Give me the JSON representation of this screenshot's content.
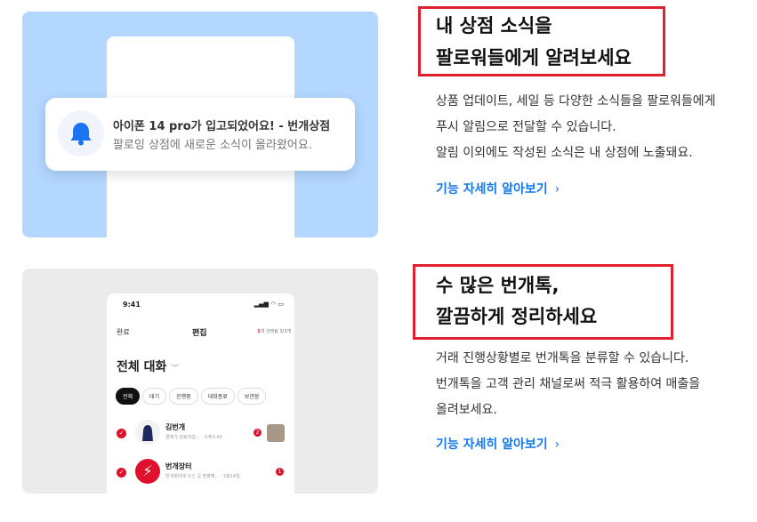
{
  "section1": {
    "notification": {
      "title": "아이폰 14 pro가 입고되었어요! - 번개상점",
      "body": "팔로잉 상점에 새로운 소식이 올라왔어요."
    },
    "headline": [
      "내 상점 소식을",
      "팔로워들에게 알려보세요"
    ],
    "description": [
      "상품 업데이트, 세일 등 다양한 소식들을 팔로워들에게",
      "푸시 알림으로 전달할 수 있습니다.",
      "알림 이외에도 작성된 소식은 내 상점에 노출돼요."
    ],
    "link": "기능 자세히 알아보기"
  },
  "section2": {
    "phone": {
      "time": "9:41",
      "status": "▂▄▆ ◠ ▭",
      "done": "완료",
      "edit": "편집",
      "selected_count": "1",
      "selected_text": "개 선택됨 3/3개",
      "heading": "전체 대화",
      "heading_chevron": "﹀",
      "chips": [
        "전체",
        "대기",
        "진행중",
        "대화종료",
        "보관함"
      ],
      "rows": [
        {
          "name": "김번개",
          "message": "결제가 완료되었... · 오후3:43",
          "badge": "2"
        },
        {
          "name": "번개장터",
          "message": "번개장터에 오신 걸 환영해... · 3월14일",
          "badge": "1"
        }
      ],
      "check_icon": "✓",
      "bolt_icon": "⚡"
    },
    "headline": [
      "수 많은 번개톡,",
      "깔끔하게 정리하세요"
    ],
    "description": [
      "거래 진행상황별로 번개톡을 분류할 수 있습니다.",
      "번개톡을 고객 관리 채널로써 적극 활용하여 매출을",
      "올려보세요."
    ],
    "link": "기능 자세히 알아보기"
  },
  "arrow_icon": "›",
  "colors": {
    "accent": "#e0202e",
    "link": "#1578ea",
    "bell": "#1a73f0",
    "card1_bg": "#b3d7ff",
    "card2_bg": "#ebebeb"
  }
}
